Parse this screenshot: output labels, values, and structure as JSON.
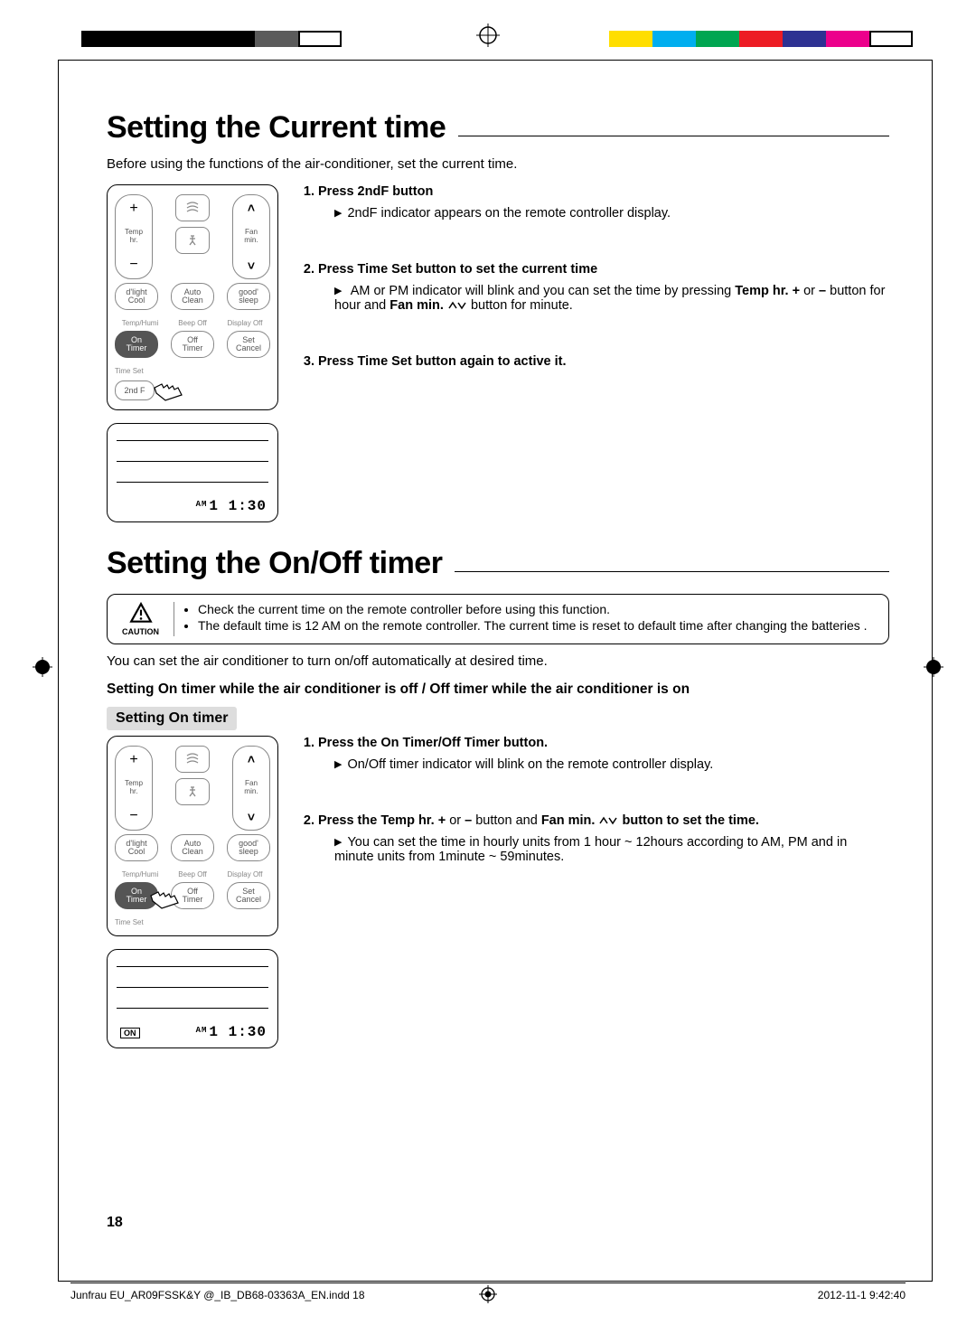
{
  "page_number": "18",
  "footer": {
    "left": "Junfrau EU_AR09FSSK&Y @_IB_DB68-03363A_EN.indd   18",
    "right": "2012-11-1   9:42:40"
  },
  "section1": {
    "heading": "Setting the Current time",
    "intro": "Before using the functions of the air-conditioner, set the current time.",
    "steps": {
      "s1_title_pre": "Press ",
      "s1_title_btn": "2ndF",
      "s1_title_post": " button",
      "s1_b1": "2ndF indicator appears on the remote controller display.",
      "s2_title_pre": "Press ",
      "s2_title_btn": "Time Set",
      "s2_title_post": " button to set the current time",
      "s2_b1_a": "AM or PM indicator will blink and you can set the time by pressing ",
      "s2_b1_b": "Temp hr. +",
      "s2_b1_c": " or ",
      "s2_b1_d": "–",
      "s2_b1_e": " button for hour and ",
      "s2_b1_f": "Fan min.",
      "s2_b1_g": " button for minute.",
      "s3_title_pre": "Press ",
      "s3_title_btn": "Time Set",
      "s3_title_post": " button again to active it."
    }
  },
  "section2": {
    "heading": "Setting the On/Off timer",
    "caution_label": "CAUTION",
    "caution": {
      "c1": "Check the current time on the remote controller before using this function.",
      "c2": "The default time is 12 AM on the remote controller. The current time is reset to default time after changing the batteries ."
    },
    "intro": "You can set the air conditioner to turn on/off automatically at desired time.",
    "sub_heading": "Setting On timer while the air conditioner is off / Off timer while the air conditioner is on",
    "tag": "Setting On timer",
    "steps": {
      "s1_title_pre": "Press the ",
      "s1_title_btn": "On Timer/Off Timer",
      "s1_title_post": " button.",
      "s1_b1": "On/Off timer indicator will blink on the remote controller display.",
      "s2_title_pre": "Press the ",
      "s2_title_b1": "Temp hr. +",
      "s2_title_mid1": " or ",
      "s2_title_b2": "–",
      "s2_title_mid2": " button and ",
      "s2_title_b3": "Fan min.",
      "s2_title_post": " button to set the time.",
      "s2_b1": "You can set the time in hourly units from 1 hour ~ 12hours according to AM, PM and in minute units from 1minute ~ 59minutes."
    }
  },
  "remote": {
    "temp_hr": "Temp\nhr.",
    "fan_min": "Fan\nmin.",
    "plus": "+",
    "minus": "−",
    "up": "˄",
    "down": "˅",
    "dlight_cool": "d'light\nCool",
    "auto_clean": "Auto\nClean",
    "good_sleep": "good'\nsleep",
    "temp_humi": "Temp/Humi",
    "beep_off": "Beep Off",
    "display_off": "Display Off",
    "on_timer": "On\nTimer",
    "off_timer": "Off\nTimer",
    "set_cancel": "Set\nCancel",
    "time_set": "Time Set",
    "second_f": "2nd F"
  },
  "display": {
    "ampm": "AM",
    "time": "1  1:30",
    "on_tag": "ON"
  }
}
